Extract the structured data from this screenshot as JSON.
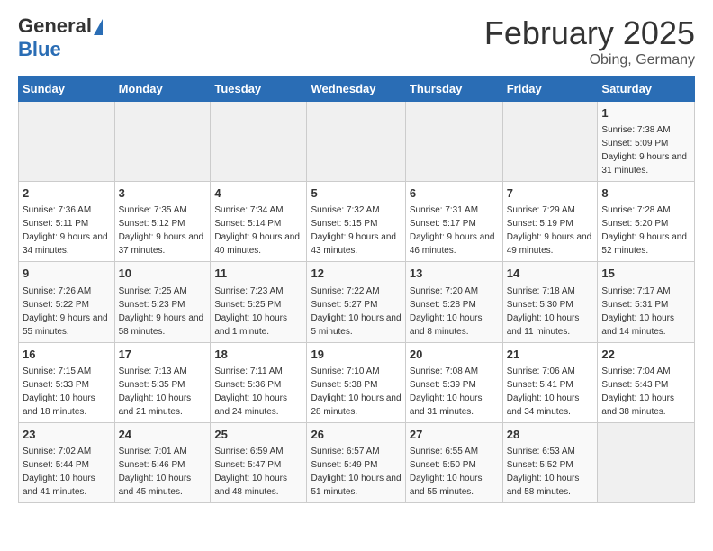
{
  "header": {
    "logo_general": "General",
    "logo_blue": "Blue",
    "month": "February 2025",
    "location": "Obing, Germany"
  },
  "weekdays": [
    "Sunday",
    "Monday",
    "Tuesday",
    "Wednesday",
    "Thursday",
    "Friday",
    "Saturday"
  ],
  "weeks": [
    [
      {
        "day": "",
        "empty": true
      },
      {
        "day": "",
        "empty": true
      },
      {
        "day": "",
        "empty": true
      },
      {
        "day": "",
        "empty": true
      },
      {
        "day": "",
        "empty": true
      },
      {
        "day": "",
        "empty": true
      },
      {
        "day": "1",
        "sunrise": "7:38 AM",
        "sunset": "5:09 PM",
        "daylight": "9 hours and 31 minutes."
      }
    ],
    [
      {
        "day": "2",
        "sunrise": "7:36 AM",
        "sunset": "5:11 PM",
        "daylight": "9 hours and 34 minutes."
      },
      {
        "day": "3",
        "sunrise": "7:35 AM",
        "sunset": "5:12 PM",
        "daylight": "9 hours and 37 minutes."
      },
      {
        "day": "4",
        "sunrise": "7:34 AM",
        "sunset": "5:14 PM",
        "daylight": "9 hours and 40 minutes."
      },
      {
        "day": "5",
        "sunrise": "7:32 AM",
        "sunset": "5:15 PM",
        "daylight": "9 hours and 43 minutes."
      },
      {
        "day": "6",
        "sunrise": "7:31 AM",
        "sunset": "5:17 PM",
        "daylight": "9 hours and 46 minutes."
      },
      {
        "day": "7",
        "sunrise": "7:29 AM",
        "sunset": "5:19 PM",
        "daylight": "9 hours and 49 minutes."
      },
      {
        "day": "8",
        "sunrise": "7:28 AM",
        "sunset": "5:20 PM",
        "daylight": "9 hours and 52 minutes."
      }
    ],
    [
      {
        "day": "9",
        "sunrise": "7:26 AM",
        "sunset": "5:22 PM",
        "daylight": "9 hours and 55 minutes."
      },
      {
        "day": "10",
        "sunrise": "7:25 AM",
        "sunset": "5:23 PM",
        "daylight": "9 hours and 58 minutes."
      },
      {
        "day": "11",
        "sunrise": "7:23 AM",
        "sunset": "5:25 PM",
        "daylight": "10 hours and 1 minute."
      },
      {
        "day": "12",
        "sunrise": "7:22 AM",
        "sunset": "5:27 PM",
        "daylight": "10 hours and 5 minutes."
      },
      {
        "day": "13",
        "sunrise": "7:20 AM",
        "sunset": "5:28 PM",
        "daylight": "10 hours and 8 minutes."
      },
      {
        "day": "14",
        "sunrise": "7:18 AM",
        "sunset": "5:30 PM",
        "daylight": "10 hours and 11 minutes."
      },
      {
        "day": "15",
        "sunrise": "7:17 AM",
        "sunset": "5:31 PM",
        "daylight": "10 hours and 14 minutes."
      }
    ],
    [
      {
        "day": "16",
        "sunrise": "7:15 AM",
        "sunset": "5:33 PM",
        "daylight": "10 hours and 18 minutes."
      },
      {
        "day": "17",
        "sunrise": "7:13 AM",
        "sunset": "5:35 PM",
        "daylight": "10 hours and 21 minutes."
      },
      {
        "day": "18",
        "sunrise": "7:11 AM",
        "sunset": "5:36 PM",
        "daylight": "10 hours and 24 minutes."
      },
      {
        "day": "19",
        "sunrise": "7:10 AM",
        "sunset": "5:38 PM",
        "daylight": "10 hours and 28 minutes."
      },
      {
        "day": "20",
        "sunrise": "7:08 AM",
        "sunset": "5:39 PM",
        "daylight": "10 hours and 31 minutes."
      },
      {
        "day": "21",
        "sunrise": "7:06 AM",
        "sunset": "5:41 PM",
        "daylight": "10 hours and 34 minutes."
      },
      {
        "day": "22",
        "sunrise": "7:04 AM",
        "sunset": "5:43 PM",
        "daylight": "10 hours and 38 minutes."
      }
    ],
    [
      {
        "day": "23",
        "sunrise": "7:02 AM",
        "sunset": "5:44 PM",
        "daylight": "10 hours and 41 minutes."
      },
      {
        "day": "24",
        "sunrise": "7:01 AM",
        "sunset": "5:46 PM",
        "daylight": "10 hours and 45 minutes."
      },
      {
        "day": "25",
        "sunrise": "6:59 AM",
        "sunset": "5:47 PM",
        "daylight": "10 hours and 48 minutes."
      },
      {
        "day": "26",
        "sunrise": "6:57 AM",
        "sunset": "5:49 PM",
        "daylight": "10 hours and 51 minutes."
      },
      {
        "day": "27",
        "sunrise": "6:55 AM",
        "sunset": "5:50 PM",
        "daylight": "10 hours and 55 minutes."
      },
      {
        "day": "28",
        "sunrise": "6:53 AM",
        "sunset": "5:52 PM",
        "daylight": "10 hours and 58 minutes."
      },
      {
        "day": "",
        "empty": true
      }
    ]
  ]
}
